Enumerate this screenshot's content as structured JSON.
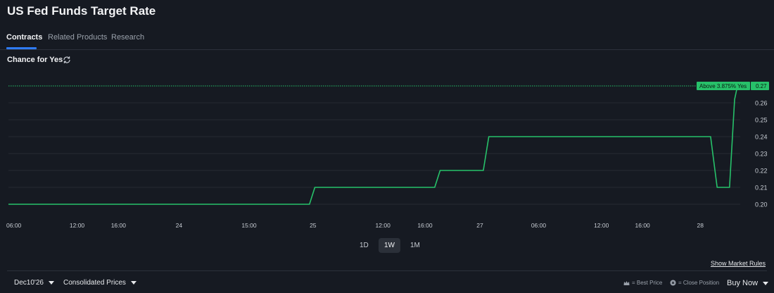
{
  "page": {
    "title": "US Fed Funds Target Rate"
  },
  "tabs": [
    {
      "label": "Contracts",
      "active": true
    },
    {
      "label": "Related Products",
      "active": false
    },
    {
      "label": "Research",
      "active": false
    }
  ],
  "section": {
    "title": "Chance for Yes",
    "refresh_icon": "refresh-icon"
  },
  "chart_data": {
    "type": "line",
    "title": "",
    "xlabel": "",
    "ylabel": "",
    "ylim": [
      0.195,
      0.275
    ],
    "y_ticks": [
      0.2,
      0.21,
      0.22,
      0.23,
      0.24,
      0.25,
      0.26
    ],
    "grid": true,
    "x_ticks": [
      "06:00",
      "12:00",
      "16:00",
      "24",
      "15:00",
      "25",
      "12:00",
      "16:00",
      "27",
      "06:00",
      "12:00",
      "16:00",
      "28"
    ],
    "x_tick_pos": [
      0.0,
      0.0945,
      0.1515,
      0.2349,
      0.3314,
      0.4194,
      0.5157,
      0.5736,
      0.6492,
      0.7301,
      0.8166,
      0.8732,
      0.9528
    ],
    "series": [
      {
        "name": "",
        "color": "#27c16a",
        "points": [
          [
            0.0,
            0.2
          ],
          [
            0.4145,
            0.2
          ],
          [
            0.422,
            0.21
          ],
          [
            0.587,
            0.21
          ],
          [
            0.5945,
            0.22
          ],
          [
            0.654,
            0.22
          ],
          [
            0.6615,
            0.24
          ],
          [
            0.967,
            0.24
          ],
          [
            0.976,
            0.21
          ],
          [
            0.993,
            0.21
          ],
          [
            1.0,
            0.262
          ],
          [
            1.004,
            0.27
          ]
        ]
      }
    ],
    "reference_line": {
      "value": 0.27,
      "label": "Above 3.875% Yes",
      "value_label": "0.27",
      "color": "#27c16a"
    }
  },
  "ranges": [
    {
      "label": "1D",
      "active": false
    },
    {
      "label": "1W",
      "active": true
    },
    {
      "label": "1M",
      "active": false
    }
  ],
  "links": {
    "market_rules": "Show Market Rules"
  },
  "footer": {
    "contract_select": "Dec10'26",
    "price_select": "Consolidated Prices",
    "best_price_legend": "= Best Price",
    "close_position_legend": "= Close Position",
    "buy_select": "Buy Now"
  },
  "colors": {
    "background": "#161a22",
    "accent": "#2f7bf6",
    "line": "#27c16a",
    "grid": "#2a2f38"
  }
}
